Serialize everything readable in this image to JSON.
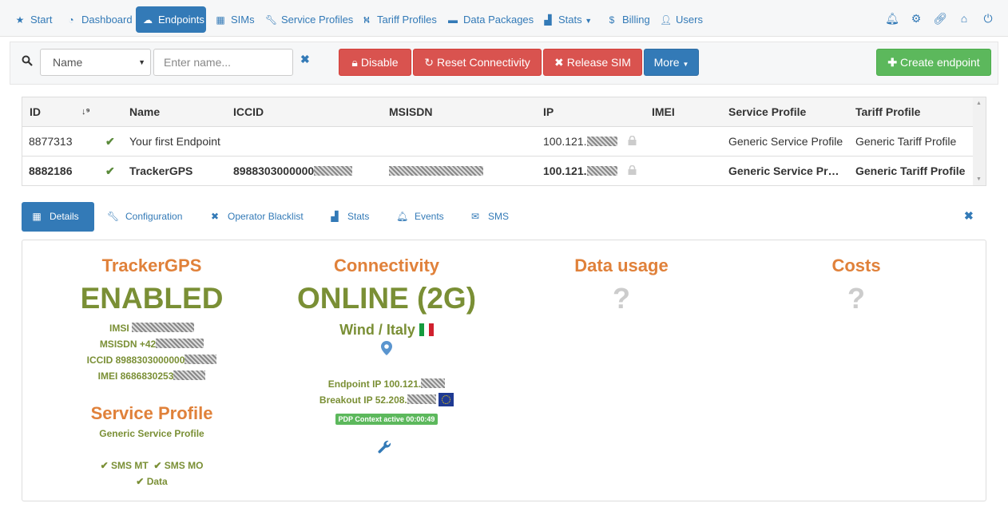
{
  "nav": {
    "items": [
      {
        "label": "Start",
        "icon": "star-icon"
      },
      {
        "label": "Dashboard",
        "icon": "dashboard-icon"
      },
      {
        "label": "Endpoints",
        "icon": "cloud-icon",
        "active": true
      },
      {
        "label": "SIMs",
        "icon": "grid-icon"
      },
      {
        "label": "Service Profiles",
        "icon": "wrench-icon"
      },
      {
        "label": "Tariff Profiles",
        "icon": "road-icon"
      },
      {
        "label": "Data Packages",
        "icon": "briefcase-icon"
      },
      {
        "label": "Stats",
        "icon": "bar-chart-icon"
      },
      {
        "label": "Billing",
        "icon": "dollar-icon"
      },
      {
        "label": "Users",
        "icon": "user-icon"
      }
    ],
    "right_icons": [
      "bell-icon",
      "gear-icon",
      "link-icon",
      "home-icon",
      "power-icon"
    ]
  },
  "toolbar": {
    "filter_select": "Name",
    "name_placeholder": "Enter name...",
    "disable_label": "Disable",
    "reset_label": "Reset Connectivity",
    "release_label": "Release SIM",
    "more_label": "More",
    "create_label": "Create endpoint"
  },
  "table": {
    "headers": [
      "ID",
      "Name",
      "ICCID",
      "MSISDN",
      "IP",
      "IMEI",
      "Service Profile",
      "Tariff Profile"
    ],
    "rows": [
      {
        "id": "8877313",
        "name": "Your first Endpoint",
        "iccid": "",
        "msisdn": "",
        "ip": "100.121.",
        "imei": "",
        "service_profile": "Generic Service Profile",
        "tariff_profile": "Generic Tariff Profile"
      },
      {
        "id": "8882186",
        "name": "TrackerGPS",
        "iccid": "8988303000000",
        "msisdn": "",
        "ip": "100.121.",
        "imei": "",
        "service_profile": "Generic Service Pr…",
        "tariff_profile": "Generic Tariff Profile"
      }
    ]
  },
  "tabs": [
    {
      "label": "Details",
      "icon": "grid-icon",
      "active": true
    },
    {
      "label": "Configuration",
      "icon": "wrench-icon"
    },
    {
      "label": "Operator Blacklist",
      "icon": "x-icon"
    },
    {
      "label": "Stats",
      "icon": "bar-chart-icon"
    },
    {
      "label": "Events",
      "icon": "bell-icon"
    },
    {
      "label": "SMS",
      "icon": "envelope-icon"
    }
  ],
  "details": {
    "endpoint": {
      "title": "TrackerGPS",
      "status": "ENABLED",
      "imsi_label": "IMSI",
      "msisdn_label": "MSISDN +42",
      "iccid_label": "ICCID 8988303000000",
      "imei_label": "IMEI 8686830253"
    },
    "service_profile": {
      "title": "Service Profile",
      "name": "Generic Service Profile",
      "sms_mt": "SMS MT",
      "sms_mo": "SMS MO",
      "data": "Data"
    },
    "connectivity": {
      "title": "Connectivity",
      "status": "ONLINE (2G)",
      "operator": "Wind / Italy",
      "endpoint_ip": "Endpoint IP 100.121.",
      "breakout_ip": "Breakout IP 52.208.",
      "pdp": "PDP Context active 00:00:49"
    },
    "data_usage": {
      "title": "Data usage",
      "value": "?"
    },
    "costs": {
      "title": "Costs",
      "value": "?"
    }
  },
  "colors": {
    "primary": "#337ab7",
    "danger": "#d9534f",
    "success": "#5cb85c",
    "orange": "#e0813a",
    "olive": "#7a8f35"
  }
}
